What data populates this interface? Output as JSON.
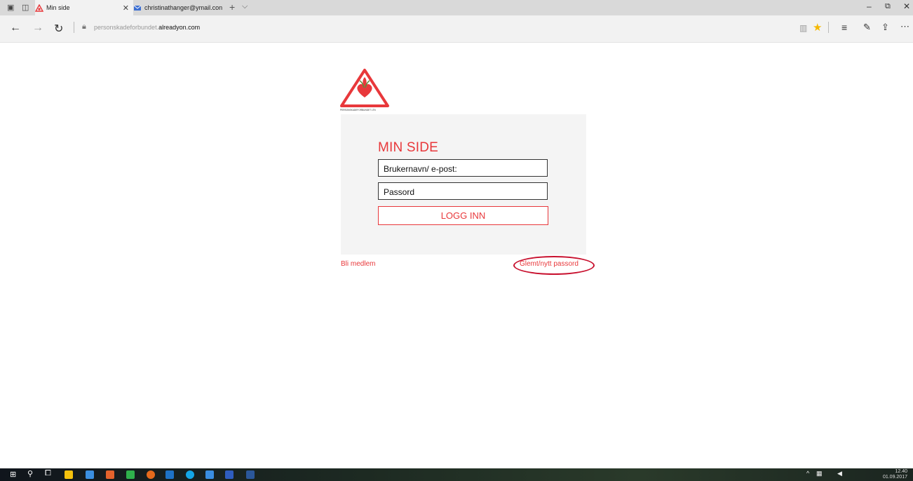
{
  "browser": {
    "tabs": [
      {
        "label": "Min side",
        "active": true
      },
      {
        "label": "christinathanger@ymail.con",
        "active": false
      }
    ],
    "url_prefix": "personskadeforbundet.",
    "url_domain": "alreadyon.com"
  },
  "logo_text": "PERSONSKADEFORBUNDET LTN",
  "login": {
    "title": "MIN SIDE",
    "username_value": "Brukernavn/ e-post:",
    "password_value": "Passord",
    "submit_label": "LOGG INN",
    "join_link": "Bli medlem",
    "forgot_link": "Glemt/nytt passord"
  },
  "taskbar": {
    "time": "12.40",
    "date": "01.09.2017"
  },
  "colors": {
    "accent": "#e8383b",
    "annotation": "#c8102e",
    "panel": "#f4f4f4"
  }
}
